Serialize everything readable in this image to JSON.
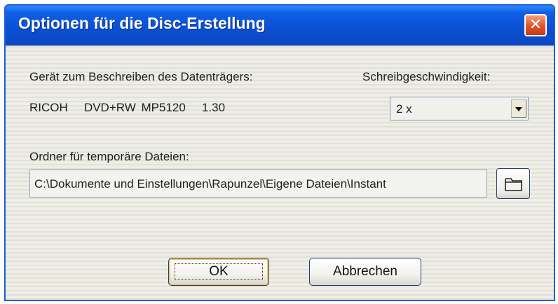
{
  "dialog": {
    "title": "Optionen für die Disc-Erstellung",
    "close_label": "✕"
  },
  "device": {
    "label": "Gerät zum Beschreiben des Datenträgers:",
    "name": "RICOH   DVD+RW MP5120   1.30"
  },
  "speed": {
    "label": "Schreibgeschwindigkeit:",
    "selected": "2 x"
  },
  "temp_folder": {
    "label": "Ordner für temporäre Dateien:",
    "path": "C:\\Dokumente und Einstellungen\\Rapunzel\\Eigene Dateien\\Instant"
  },
  "buttons": {
    "ok": "OK",
    "cancel": "Abbrechen"
  },
  "icons": {
    "close": "close-icon",
    "dropdown": "chevron-down-icon",
    "browse": "folder-icon"
  },
  "colors": {
    "titlebar": "#0b4fd2",
    "close_button": "#e0522a",
    "window_background": "#ebebe3"
  }
}
